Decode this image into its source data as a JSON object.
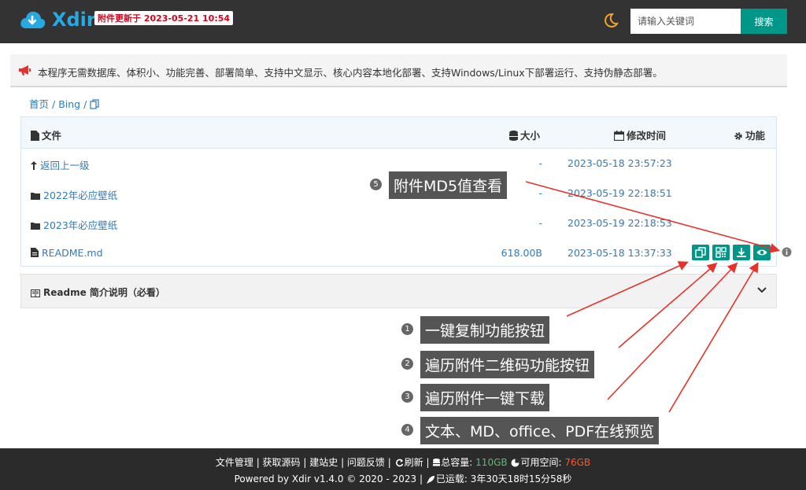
{
  "header": {
    "logo_text": "Xdir",
    "update_badge": "附件更新于 2023-05-21 10:54",
    "search_placeholder": "请输入关键词",
    "search_button": "搜索"
  },
  "notice": {
    "text": "本程序无需数据库、体积小、功能完善、部署简单、支持中文显示、核心内容本地化部署、支持Windows/Linux下部署运行、支持伪静态部署。"
  },
  "breadcrumb": {
    "home": "首页",
    "current": "Bing"
  },
  "table": {
    "headers": {
      "file": "文件",
      "size": "大小",
      "time": "修改时间",
      "action": "功能"
    },
    "rows": [
      {
        "name": "返回上一级",
        "size": "-",
        "time": "2023-05-18 23:57:23",
        "icon": "return-icon"
      },
      {
        "name": "2022年必应壁纸",
        "size": "-",
        "time": "2023-05-19 22:18:51",
        "icon": "folder-icon"
      },
      {
        "name": "2023年必应壁纸",
        "size": "-",
        "time": "2023-05-19 22:18:53",
        "icon": "folder-icon"
      },
      {
        "name": "README.md",
        "size": "618.00B",
        "time": "2023-05-18 13:37:33",
        "icon": "file-icon"
      }
    ]
  },
  "readme": {
    "title": "Readme 简介说明（必看）"
  },
  "annotations": {
    "a1": {
      "num": "1",
      "text": "一键复制功能按钮"
    },
    "a2": {
      "num": "2",
      "text": "遍历附件二维码功能按钮"
    },
    "a3": {
      "num": "3",
      "text": "遍历附件一键下载"
    },
    "a4": {
      "num": "4",
      "text": "文本、MD、office、PDF在线预览"
    },
    "a5": {
      "num": "5",
      "text": "附件MD5值查看"
    }
  },
  "footer": {
    "links": [
      "文件管理",
      "获取源码",
      "建站史",
      "问题反馈",
      "刷新"
    ],
    "total_label": "总容量:",
    "total_value": "110GB",
    "free_label": "可用空间:",
    "free_value": "76GB",
    "powered": "Powered by Xdir v1.4.0",
    "copyright": "© 2020 - 2023",
    "uptime_label": "已运载:",
    "uptime_value": "3年30天18时15分58秒"
  },
  "colors": {
    "header_bg": "#333333",
    "accent": "#009688",
    "link": "#337ab7",
    "arrow": "#e8312a",
    "badge_text": "#d9001b"
  }
}
